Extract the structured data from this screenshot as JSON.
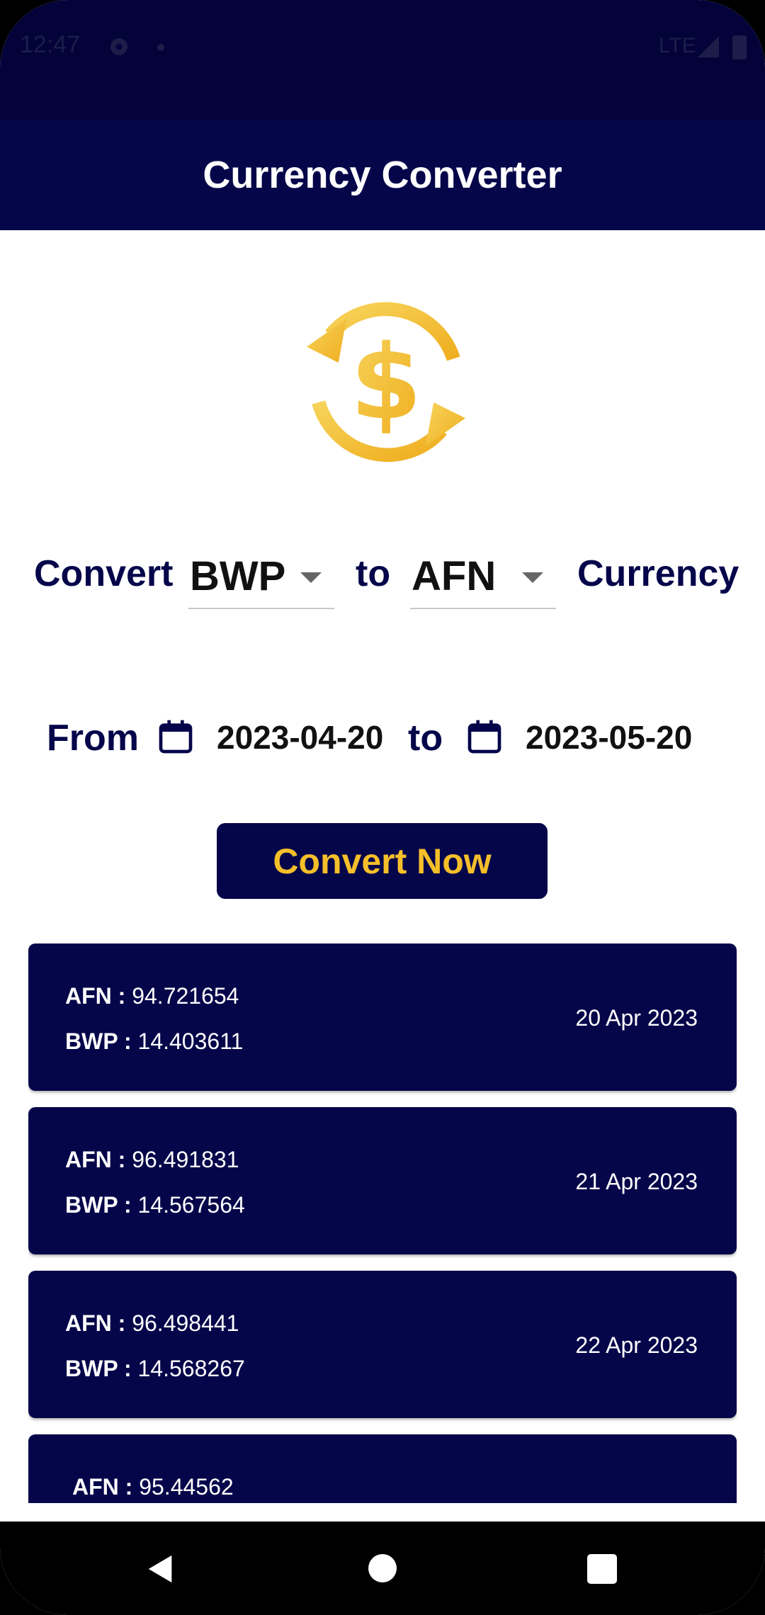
{
  "status_bar": {
    "time": "12:47",
    "network": "LTE",
    "icons": [
      "gear-icon",
      "dot-icon",
      "signal-icon",
      "battery-icon"
    ]
  },
  "app_bar": {
    "title": "Currency Converter"
  },
  "logo": {
    "icon": "currency-exchange-icon",
    "color": "#f5bf2a"
  },
  "converter": {
    "convert_label": "Convert",
    "from_currency": "BWP",
    "to_label": "to",
    "to_currency": "AFN",
    "currency_label": "Currency"
  },
  "date_range": {
    "from_label": "From",
    "from_date": "2023-04-20",
    "to_label": "to",
    "to_date": "2023-05-20"
  },
  "convert_button": {
    "label": "Convert Now"
  },
  "results": [
    {
      "afn_label": "AFN :",
      "afn_value": "94.721654",
      "bwp_label": "BWP :",
      "bwp_value": "14.403611",
      "date": "20 Apr 2023"
    },
    {
      "afn_label": "AFN :",
      "afn_value": "96.491831",
      "bwp_label": "BWP :",
      "bwp_value": "14.567564",
      "date": "21 Apr 2023"
    },
    {
      "afn_label": "AFN :",
      "afn_value": "96.498441",
      "bwp_label": "BWP :",
      "bwp_value": "14.568267",
      "date": "22 Apr 2023"
    },
    {
      "afn_label": "AFN :",
      "afn_value": "95.44562",
      "bwp_label": "",
      "bwp_value": "",
      "date": ""
    }
  ],
  "colors": {
    "primary": "#05054a",
    "accent": "#f5bf2a",
    "background": "#ffffff"
  }
}
